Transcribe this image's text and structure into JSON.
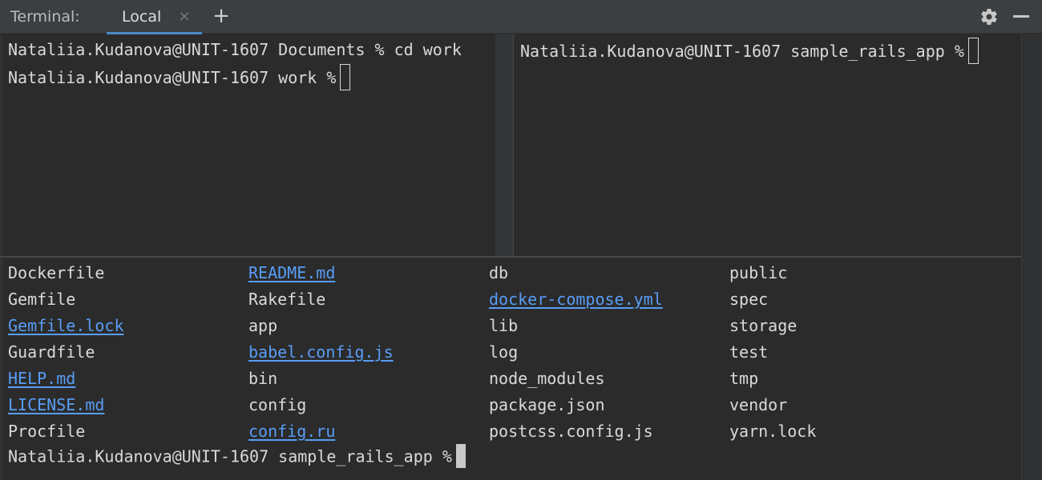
{
  "toolbar": {
    "title": "Terminal:",
    "tab_label": "Local",
    "tab_close": "×",
    "add_tab": "+",
    "gear_icon": "gear-icon",
    "minimize_icon": "minimize-icon"
  },
  "colors": {
    "background": "#2b2b2b",
    "toolbar": "#3c3f41",
    "tab_underline": "#4a88c7",
    "text": "#dadada",
    "link": "#589df6"
  },
  "pane_top_left": {
    "lines": [
      "Nataliia.Kudanova@UNIT-1607 Documents % cd work",
      "Nataliia.Kudanova@UNIT-1607 work %"
    ]
  },
  "pane_top_right": {
    "lines": [
      "Nataliia.Kudanova@UNIT-1607 sample_rails_app %"
    ]
  },
  "pane_bottom": {
    "listing": [
      {
        "name": "Dockerfile",
        "link": false
      },
      {
        "name": "Gemfile",
        "link": false
      },
      {
        "name": "Gemfile.lock",
        "link": true
      },
      {
        "name": "Guardfile",
        "link": false
      },
      {
        "name": "HELP.md",
        "link": true
      },
      {
        "name": "LICENSE.md",
        "link": true
      },
      {
        "name": "Procfile",
        "link": false
      },
      {
        "name": "README.md",
        "link": true
      },
      {
        "name": "Rakefile",
        "link": false
      },
      {
        "name": "app",
        "link": false
      },
      {
        "name": "babel.config.js",
        "link": true
      },
      {
        "name": "bin",
        "link": false
      },
      {
        "name": "config",
        "link": false
      },
      {
        "name": "config.ru",
        "link": true
      },
      {
        "name": "db",
        "link": false
      },
      {
        "name": "docker-compose.yml",
        "link": true
      },
      {
        "name": "lib",
        "link": false
      },
      {
        "name": "log",
        "link": false
      },
      {
        "name": "node_modules",
        "link": false
      },
      {
        "name": "package.json",
        "link": false
      },
      {
        "name": "postcss.config.js",
        "link": false
      },
      {
        "name": "public",
        "link": false
      },
      {
        "name": "spec",
        "link": false
      },
      {
        "name": "storage",
        "link": false
      },
      {
        "name": "test",
        "link": false
      },
      {
        "name": "tmp",
        "link": false
      },
      {
        "name": "vendor",
        "link": false
      },
      {
        "name": "yarn.lock",
        "link": false
      }
    ],
    "prompt": "Nataliia.Kudanova@UNIT-1607 sample_rails_app %"
  }
}
